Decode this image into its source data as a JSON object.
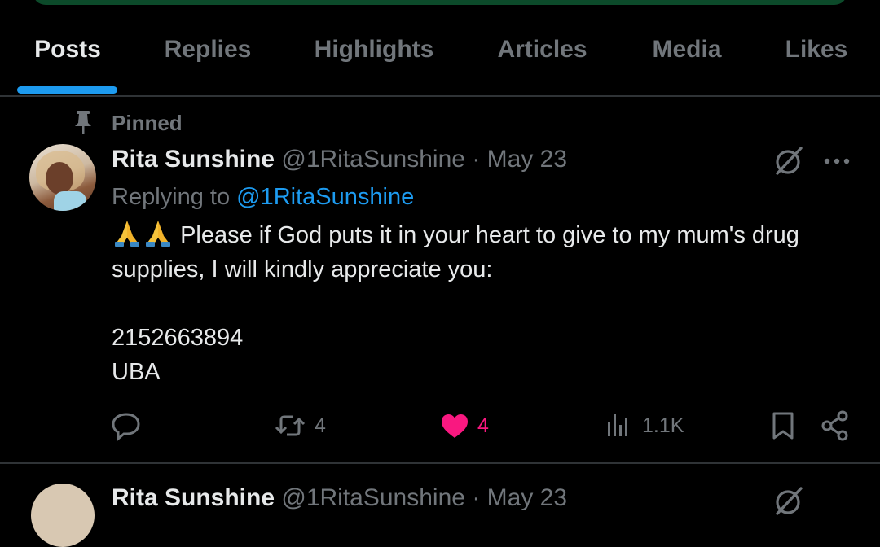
{
  "tabs": [
    {
      "label": "Posts",
      "active": true
    },
    {
      "label": "Replies",
      "active": false
    },
    {
      "label": "Highlights",
      "active": false
    },
    {
      "label": "Articles",
      "active": false
    },
    {
      "label": "Media",
      "active": false
    },
    {
      "label": "Likes",
      "active": false
    }
  ],
  "pinned_post": {
    "pinned_label": "Pinned",
    "author": {
      "name": "Rita Sunshine",
      "handle": "@1RitaSunshine"
    },
    "separator": "·",
    "date": "May 23",
    "replying_prefix": "Replying to",
    "replying_to": "@1RitaSunshine",
    "emoji": "folded-hands",
    "text_line1": "Please if God puts it in your heart to give to my mum's drug supplies, I will kindly appreciate you:",
    "account_number": "2152663894",
    "bank": "UBA",
    "stats": {
      "reposts": "4",
      "likes": "4",
      "views": "1.1K"
    },
    "liked": true
  },
  "next_post": {
    "author": {
      "name": "Rita Sunshine",
      "handle": "@1RitaSunshine"
    },
    "separator": "·",
    "date": "May 23"
  },
  "colors": {
    "background": "#000000",
    "accent_blue": "#1d9bf0",
    "like_pink": "#f91880",
    "muted": "#71767b",
    "text": "#e7e9ea"
  },
  "icons": [
    "pin-icon",
    "grok-icon",
    "more-icon",
    "reply-icon",
    "repost-icon",
    "heart-icon",
    "views-icon",
    "bookmark-icon",
    "share-icon"
  ]
}
